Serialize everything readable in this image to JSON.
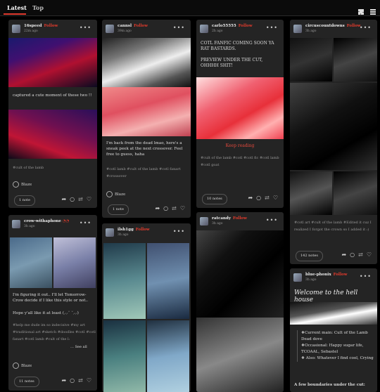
{
  "tabs": [
    "Latest",
    "Top"
  ],
  "follow": "Follow",
  "posts": [
    {
      "user": "16speed",
      "time": "22m ago",
      "text": "captured a cute moment of these two !!",
      "tags": "#cult of the lamb",
      "reblog": "Blaze",
      "notes": "1 note"
    },
    {
      "user": "crow-withaphone",
      "time": "3h ago",
      "text1": "I'm figuring it out.. I'll let Tomorrow-Crow decide if I like this style or not..",
      "text2": "Hope y'all like it at least (⸝⸝˘ ˘⸝⸝)",
      "tags": "#help me dude im so indecisive  #my art  #traditional art  #sketch  #doodles  #cotl  #cotl fanart  #cotl lamb  #cult of the l:",
      "seeall": "… See all",
      "reblog": "Blaze",
      "notes": "11 notes"
    },
    {
      "user": "cannsl",
      "time": "39m ago",
      "text": "I'm back from the dead lmao, here's a sneak peek at the next crossover. Feel free to guess, haha",
      "tags": "#cotl lamb  #cult of the lamb  #cotl fanart  #crossover",
      "reblog": "Blaze",
      "notes": "1 note"
    },
    {
      "user": "ilsh1gg",
      "time": "3h ago"
    },
    {
      "user": "carlo55555",
      "time": "2h ago",
      "text1": "COTL FANFIC COMING SOON YA RAT BASTARDS.",
      "text2": "PREVIEW UNDER THE CUT, OHHHH SHIT!",
      "keep": "Keep reading",
      "tags": "#cult of the lamb  #cotl  #cotl fic  #cotl lamb  #cotl goat",
      "notes": "10 notes"
    },
    {
      "user": "ratcandy",
      "time": "3h ago"
    },
    {
      "user": "circuscountdowns",
      "time": "3h ago",
      "tags": "#cotl art  #cult of the lamb  #Edited it cuz I realized I forgot the crown so I added it :)",
      "notes": "142 notes"
    },
    {
      "user": "blue-phonix",
      "time": "3h ago",
      "title": "Welcome to the hell house",
      "bullets": [
        "❖Current main: Cult of the Lamb Dead dove",
        "❖Occasional: Happy sugar life, TCOAAL, Sebastel",
        "❖ Also: Whatever I find cool, Crying"
      ],
      "footer": "A few boundaries under the cut:"
    }
  ],
  "colors": {
    "accent": "#e23b2c",
    "card": "#242424",
    "bg": "#000000"
  },
  "icons": [
    "grid-view-icon",
    "list-view-icon",
    "more-icon",
    "reblog-icon",
    "share-icon",
    "comment-icon",
    "repost-icon",
    "like-icon"
  ]
}
